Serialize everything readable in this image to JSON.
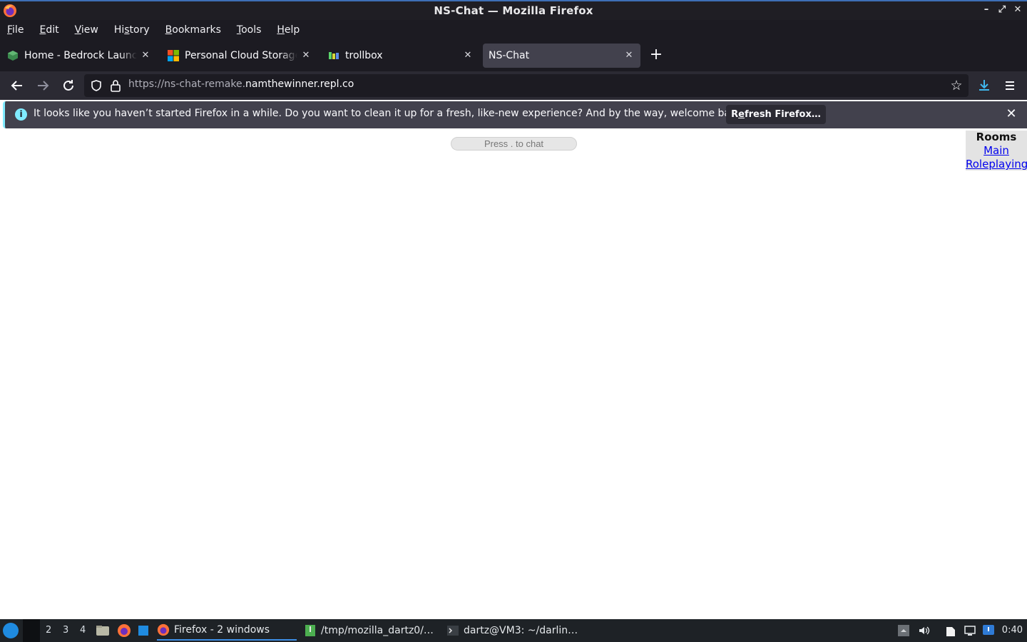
{
  "window": {
    "title": "NS-Chat — Mozilla Firefox"
  },
  "menubar": [
    {
      "pre": "",
      "u": "F",
      "post": "ile"
    },
    {
      "pre": "",
      "u": "E",
      "post": "dit"
    },
    {
      "pre": "",
      "u": "V",
      "post": "iew"
    },
    {
      "pre": "Hi",
      "u": "s",
      "post": "tory"
    },
    {
      "pre": "",
      "u": "B",
      "post": "ookmarks"
    },
    {
      "pre": "",
      "u": "T",
      "post": "ools"
    },
    {
      "pre": "",
      "u": "H",
      "post": "elp"
    }
  ],
  "tabs": [
    {
      "label": "Home - Bedrock Launcher",
      "icon": "bedrock-cube-icon"
    },
    {
      "label": "Personal Cloud Storage - Microsoft OneDrive",
      "icon": "microsoft-logo-icon"
    },
    {
      "label": "trollbox",
      "icon": "trollbox-icon"
    },
    {
      "label": "NS-Chat",
      "icon": "none",
      "active": true
    }
  ],
  "navbar": {
    "url_prefix": "https://ns-chat-remake.",
    "url_domain": "namthewinner.repl.co"
  },
  "notification": {
    "message": "It looks like you haven’t started Firefox in a while. Do you want to clean it up for a fresh, like-new experience? And by the way, welcome back!",
    "button_pre": "R",
    "button_u": "e",
    "button_post": "fresh Firefox…"
  },
  "page": {
    "chat_hint": "Press . to chat",
    "rooms_heading": "Rooms",
    "rooms": [
      "Main",
      "Roleplaying"
    ]
  },
  "taskbar": {
    "workspaces": [
      "2",
      "3",
      "4"
    ],
    "tasks": [
      {
        "label": "Firefox - 2 windows",
        "icon": "firefox-icon",
        "active": true
      },
      {
        "label": "/tmp/mozilla_dartz0/…",
        "icon": "file-archive-icon"
      },
      {
        "label": "dartz@VM3: ~/darlin…",
        "icon": "terminal-icon"
      }
    ],
    "clock": "0:40"
  },
  "colors": {
    "accent": "#3d8ee6",
    "info": "#80ebff",
    "link": "#0000ee"
  }
}
